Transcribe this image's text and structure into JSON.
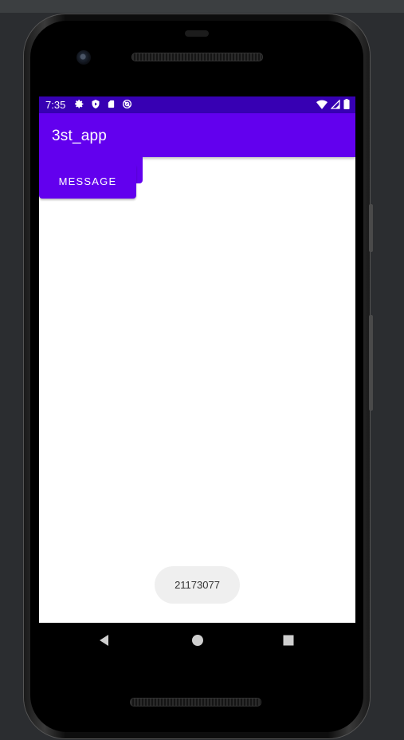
{
  "status_bar": {
    "time": "7:35",
    "left_icons": [
      "settings-icon",
      "shield-play-icon",
      "sd-card-icon",
      "do-not-disturb-icon"
    ],
    "right_icons": [
      "wifi-icon",
      "cell-signal-icon",
      "battery-icon"
    ]
  },
  "app_bar": {
    "title": "3st_app"
  },
  "main": {
    "message_button_label": "MESSAGE"
  },
  "toast": {
    "text": "21173077"
  },
  "nav_bar": {
    "buttons": [
      "back-icon",
      "home-icon",
      "recents-icon"
    ]
  },
  "colors": {
    "primary": "#6200ee",
    "primary_dark": "#3700b3",
    "toast_bg": "#efefef"
  }
}
